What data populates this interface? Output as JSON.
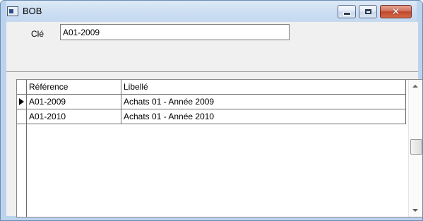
{
  "window": {
    "title": "BOB",
    "close_glyph": "✕"
  },
  "form": {
    "key_label": "Clé",
    "key_value": "A01-2009"
  },
  "grid": {
    "columns": [
      "Référence",
      "Libellé"
    ],
    "rows": [
      [
        "A01-2009",
        "Achats 01 - Année 2009"
      ],
      [
        "A01-2010",
        "Achats 01 - Année 2010"
      ]
    ],
    "selected_row": 0
  }
}
